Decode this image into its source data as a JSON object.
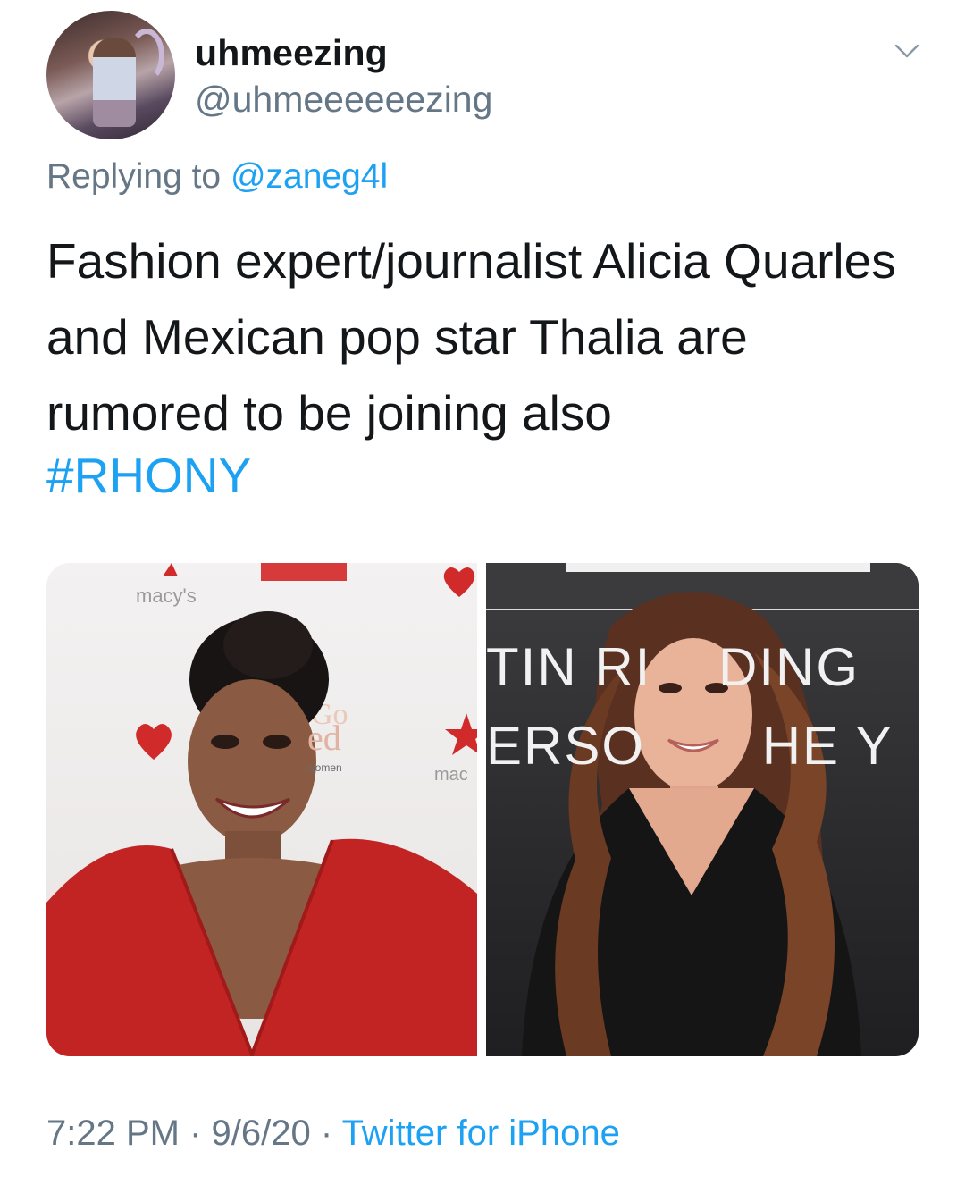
{
  "author": {
    "display_name": "uhmeezing",
    "handle": "@uhmeeeeeezing"
  },
  "reply": {
    "prefix": "Replying to ",
    "mention": "@zaneg4l"
  },
  "tweet": {
    "text": "Fashion expert/journalist Alicia Quarles and Mexican pop star Thalia are rumored to be joining also",
    "hashtag": "#RHONY"
  },
  "media": {
    "left_photo": {
      "brand_text": "macy's",
      "go_text": "Go",
      "red_text": "ed",
      "women_text": "women",
      "macy_small": "mac"
    },
    "right_photo": {
      "line1": "TIN RI    DING",
      "line2": "ERSO       HE Y"
    }
  },
  "footer": {
    "time": "7:22 PM",
    "separator": " · ",
    "date": "9/6/20",
    "source": "Twitter for iPhone"
  },
  "colors": {
    "link": "#1da1f2",
    "secondary_text": "#657786",
    "primary_text": "#14171a"
  },
  "icons": {
    "avatar": "profile-avatar",
    "menu": "chevron-down-icon"
  }
}
